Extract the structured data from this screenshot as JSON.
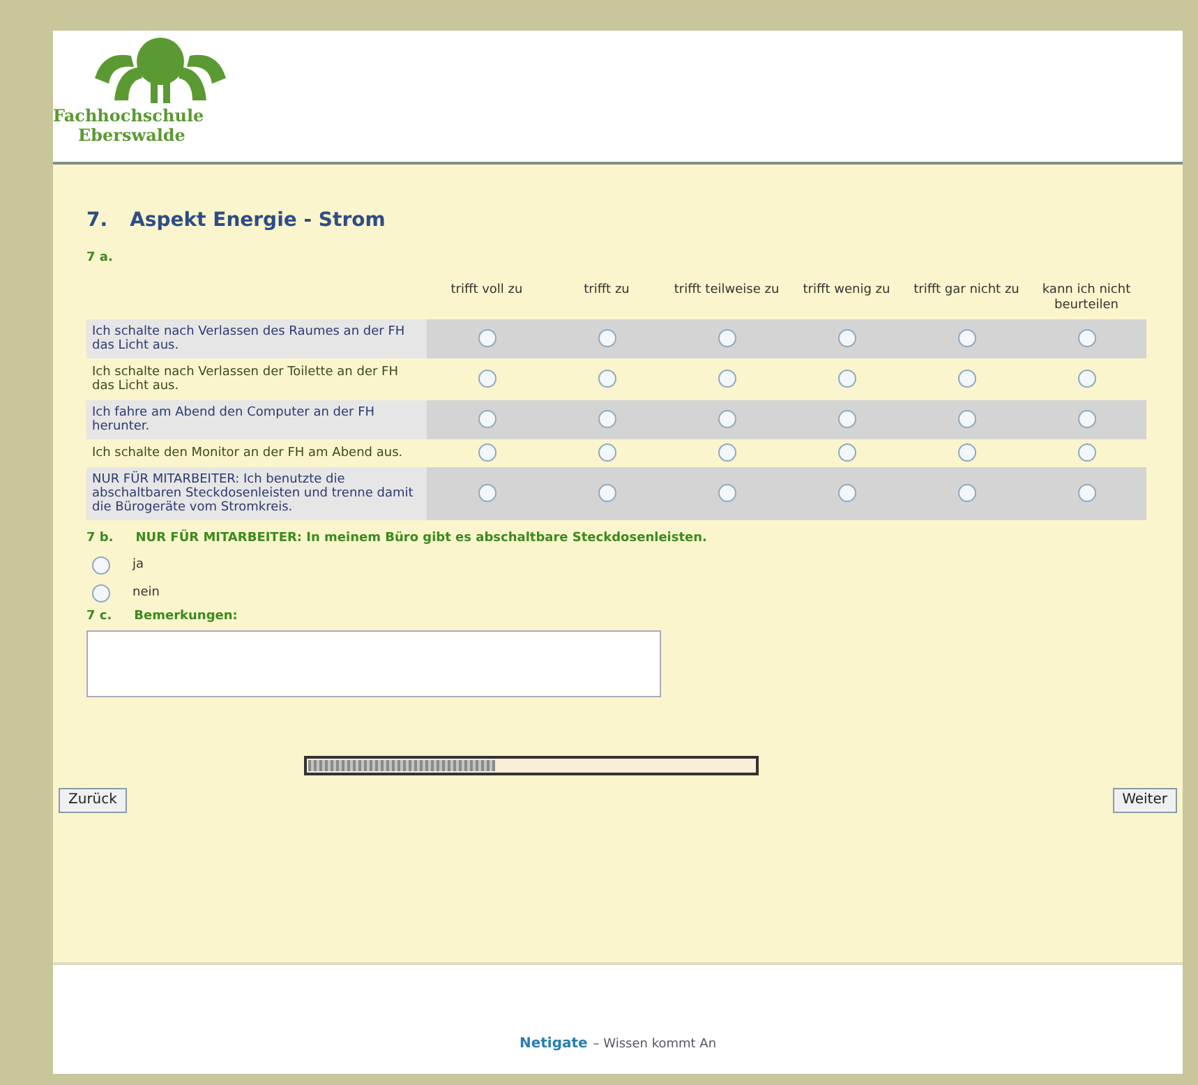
{
  "logo": {
    "line1": "Fachhochschule",
    "line2": "Eberswalde"
  },
  "section": {
    "number": "7.",
    "title": "Aspekt Energie - Strom"
  },
  "q7a": {
    "label": "7 a.",
    "columns": [
      "trifft voll zu",
      "trifft zu",
      "trifft teilweise zu",
      "trifft wenig zu",
      "trifft gar nicht zu",
      "kann ich nicht beurteilen"
    ],
    "rows": [
      {
        "text": "Ich schalte nach Verlassen des Raumes an der FH das Licht aus.",
        "options": [
          {
            "selected": false
          },
          {
            "selected": false
          },
          {
            "selected": false
          },
          {
            "selected": false
          },
          {
            "selected": false
          },
          {
            "selected": false
          }
        ]
      },
      {
        "text": "Ich schalte nach Verlassen der Toilette an der FH das Licht aus.",
        "options": [
          {
            "selected": false
          },
          {
            "selected": false
          },
          {
            "selected": false
          },
          {
            "selected": false
          },
          {
            "selected": false
          },
          {
            "selected": false
          }
        ]
      },
      {
        "text": "Ich fahre am Abend den Computer an der FH herunter.",
        "options": [
          {
            "selected": false
          },
          {
            "selected": false
          },
          {
            "selected": false
          },
          {
            "selected": false
          },
          {
            "selected": false
          },
          {
            "selected": false
          }
        ]
      },
      {
        "text": "Ich schalte den Monitor an der FH am Abend aus.",
        "options": [
          {
            "selected": false
          },
          {
            "selected": false
          },
          {
            "selected": false
          },
          {
            "selected": false
          },
          {
            "selected": false
          },
          {
            "selected": false
          }
        ]
      },
      {
        "text": "NUR FÜR MITARBEITER: Ich benutzte die abschaltbaren Steckdosenleisten und trenne damit die Bürogeräte vom Stromkreis.",
        "options": [
          {
            "selected": false
          },
          {
            "selected": false
          },
          {
            "selected": false
          },
          {
            "selected": false
          },
          {
            "selected": false
          },
          {
            "selected": false
          }
        ]
      }
    ]
  },
  "q7b": {
    "label": "7 b.",
    "question": "NUR FÜR MITARBEITER: In meinem Büro gibt es abschaltbare Steckdosenleisten.",
    "options": [
      {
        "text": "ja",
        "selected": false
      },
      {
        "text": "nein",
        "selected": false
      }
    ]
  },
  "q7c": {
    "label": "7 c.",
    "question": "Bemerkungen:"
  },
  "progress": {
    "level": 0.42
  },
  "buttons": {
    "back": "Zurück",
    "next": "Weiter"
  },
  "footer": {
    "brand": "Netigate",
    "slogan": "– Wissen kommt An"
  }
}
